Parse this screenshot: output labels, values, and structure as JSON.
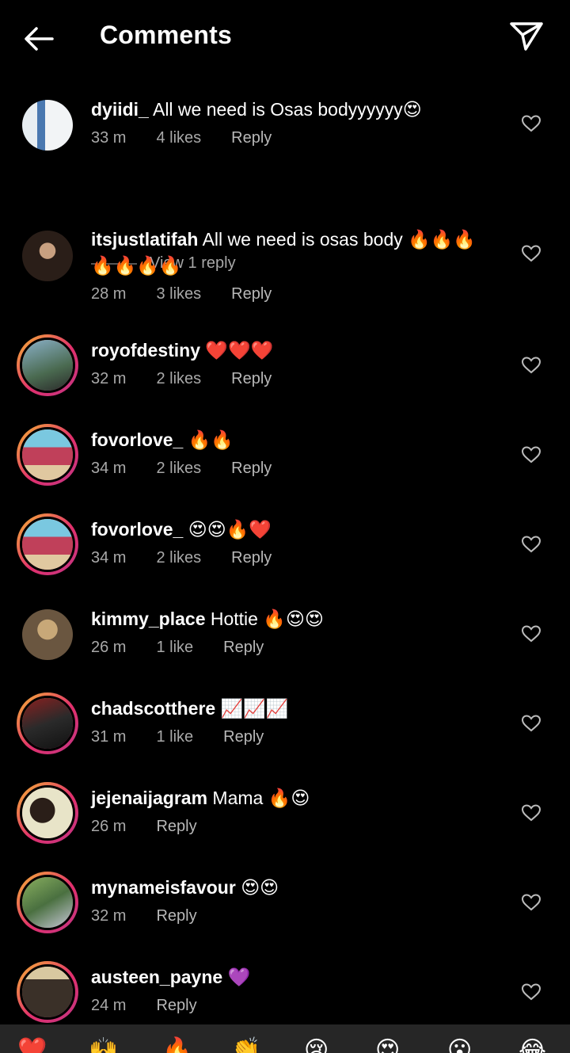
{
  "header": {
    "title": "Comments"
  },
  "comments": [
    {
      "username": "dyiidi_",
      "text": "All we need is Osas bodyyyyyy😍",
      "time": "33 m",
      "likes": "4 likes",
      "reply": "Reply",
      "avatar_color": "#9aa8b8"
    },
    {
      "username": "itsjustlatifah",
      "text": "All we need is osas body 🔥🔥🔥",
      "text2": "🔥🔥🔥🔥",
      "time": "28 m",
      "likes": "3 likes",
      "reply": "Reply",
      "avatar_color": "#5a4538"
    },
    {
      "username": "royofdestiny",
      "text": "❤️❤️❤️",
      "time": "32 m",
      "likes": "2 likes",
      "reply": "Reply",
      "avatar_color": "#5c7a8a"
    },
    {
      "username": "fovorlove_",
      "text": "🔥🔥",
      "time": "34 m",
      "likes": "2 likes",
      "reply": "Reply",
      "avatar_color": "#c0505a"
    },
    {
      "username": "fovorlove_",
      "text": "😍😍🔥❤️",
      "time": "34 m",
      "likes": "2 likes",
      "reply": "Reply",
      "avatar_color": "#c0505a"
    },
    {
      "username": "kimmy_place",
      "text": "Hottie 🔥😍😍",
      "time": "26 m",
      "likes": "1 like",
      "reply": "Reply",
      "avatar_color": "#7a6650"
    },
    {
      "username": "chadscotthere",
      "text": "📈📈📈",
      "time": "31 m",
      "likes": "1 like",
      "reply": "Reply",
      "avatar_color": "#3a2a2a"
    },
    {
      "username": "jejenaijagram",
      "text": "Mama 🔥😍",
      "time": "26 m",
      "likes": "",
      "reply": "Reply",
      "avatar_color": "#e8e0b0"
    },
    {
      "username": "mynameisfavour",
      "text": "😍😍",
      "time": "32 m",
      "likes": "",
      "reply": "Reply",
      "avatar_color": "#6a8a4a"
    },
    {
      "username": "austeen_payne",
      "text": "💜",
      "time": "24 m",
      "likes": "",
      "reply": "Reply",
      "avatar_color": "#4a4038"
    }
  ],
  "view_reply": "View 1 reply",
  "emoji_bar": [
    "❤️",
    "🙌",
    "🔥",
    "👏",
    "😢",
    "😍",
    "😮",
    "😂"
  ],
  "colors": {
    "background": "#000000",
    "secondary_text": "#a8a8a8",
    "ring_start": "#f7b733",
    "ring_end": "#c13584"
  }
}
